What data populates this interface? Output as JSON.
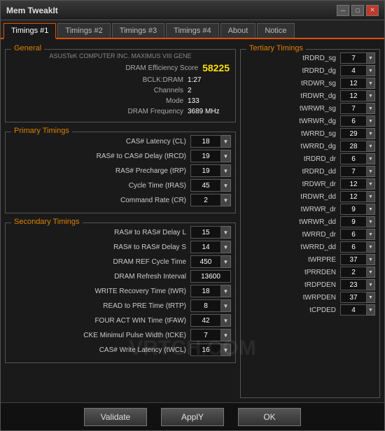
{
  "window": {
    "title": "Mem TweakIt",
    "minimize_label": "─",
    "restore_label": "□",
    "close_label": "✕"
  },
  "tabs": [
    {
      "label": "Timings #1",
      "active": true
    },
    {
      "label": "Timings #2",
      "active": false
    },
    {
      "label": "Timings #3",
      "active": false
    },
    {
      "label": "Timings #4",
      "active": false
    },
    {
      "label": "About",
      "active": false
    },
    {
      "label": "Notice",
      "active": false
    }
  ],
  "general": {
    "label": "General",
    "motherboard": "ASUSTeK COMPUTER INC. MAXIMUS VIII GENE",
    "dram_efficiency_label": "DRAM Efficiency Score",
    "dram_efficiency_value": "58225",
    "bclk_label": "BCLK:DRAM",
    "bclk_value": "1:27",
    "channels_label": "Channels",
    "channels_value": "2",
    "mode_label": "Mode",
    "mode_value": "133",
    "freq_label": "DRAM Frequency",
    "freq_value": "3689 MHz"
  },
  "primary": {
    "label": "Primary Timings",
    "rows": [
      {
        "label": "CAS# Latency (CL)",
        "value": "18"
      },
      {
        "label": "RAS# to CAS# Delay (tRCD)",
        "value": "19"
      },
      {
        "label": "RAS# Precharge (tRP)",
        "value": "19"
      },
      {
        "label": "Cycle Time (tRAS)",
        "value": "45"
      },
      {
        "label": "Command Rate (CR)",
        "value": "2"
      }
    ]
  },
  "secondary": {
    "label": "Secondary Timings",
    "rows": [
      {
        "label": "RAS# to RAS# Delay L",
        "value": "15"
      },
      {
        "label": "RAS# to RAS# Delay S",
        "value": "14"
      },
      {
        "label": "DRAM REF Cycle Time",
        "value": "450"
      },
      {
        "label": "DRAM Refresh Interval",
        "value": "13600"
      },
      {
        "label": "WRITE Recovery Time (tWR)",
        "value": "18"
      },
      {
        "label": "READ to PRE Time (tRTP)",
        "value": "8"
      },
      {
        "label": "FOUR ACT WIN Time (tFAW)",
        "value": "42"
      },
      {
        "label": "CKE Minimul Pulse Width (tCKE)",
        "value": "7"
      },
      {
        "label": "CAS# Write Latency (tWCL)",
        "value": "16"
      }
    ]
  },
  "tertiary": {
    "label": "Tertiary Timings",
    "rows": [
      {
        "label": "tRDRD_sg",
        "value": "7"
      },
      {
        "label": "tRDRD_dg",
        "value": "4"
      },
      {
        "label": "tRDWR_sg",
        "value": "12"
      },
      {
        "label": "tRDWR_dg",
        "value": "12"
      },
      {
        "label": "tWRWR_sg",
        "value": "7"
      },
      {
        "label": "tWRWR_dg",
        "value": "6"
      },
      {
        "label": "tWRRD_sg",
        "value": "29"
      },
      {
        "label": "tWRRD_dg",
        "value": "28"
      },
      {
        "label": "tRDRD_dr",
        "value": "6"
      },
      {
        "label": "tRDRD_dd",
        "value": "7"
      },
      {
        "label": "tRDWR_dr",
        "value": "12"
      },
      {
        "label": "tRDWR_dd",
        "value": "12"
      },
      {
        "label": "tWRWR_dr",
        "value": "9"
      },
      {
        "label": "tWRWR_dd",
        "value": "9"
      },
      {
        "label": "tWRRD_dr",
        "value": "6"
      },
      {
        "label": "tWRRD_dd",
        "value": "6"
      },
      {
        "label": "tWRPRE",
        "value": "37"
      },
      {
        "label": "tPRRDEN",
        "value": "2"
      },
      {
        "label": "tRDPDEN",
        "value": "23"
      },
      {
        "label": "tWRPDEN",
        "value": "37"
      },
      {
        "label": "tCPDED",
        "value": "4"
      }
    ]
  },
  "footer": {
    "validate_label": "Validate",
    "apply_label": "ApplY",
    "ok_label": "OK"
  }
}
